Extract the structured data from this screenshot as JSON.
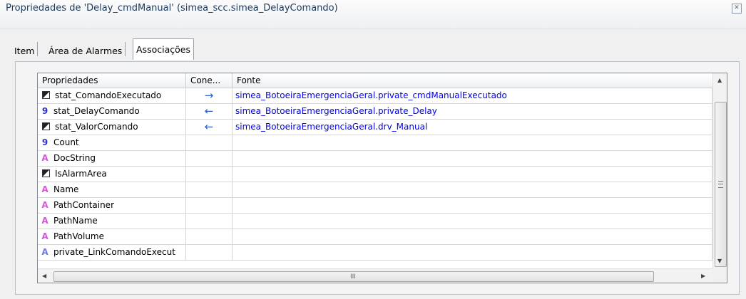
{
  "window": {
    "title": "Propriedades de 'Delay_cmdManual' (simea_scc.simea_DelayComando)",
    "close_icon": "close-icon"
  },
  "tabs": [
    {
      "label": "Item",
      "active": false
    },
    {
      "label": "Área de Alarmes",
      "active": false
    },
    {
      "label": "Associações",
      "active": true
    }
  ],
  "grid": {
    "columns": [
      "Propriedades",
      "Cone...",
      "Fonte"
    ],
    "rows": [
      {
        "icon": "bool",
        "name": "stat_ComandoExecutado",
        "connection": "→",
        "source": "simea_BotoeiraEmergenciaGeral.private_cmdManualExecutado"
      },
      {
        "icon": "int",
        "name": "stat_DelayComando",
        "connection": "←",
        "source": "simea_BotoeiraEmergenciaGeral.private_Delay"
      },
      {
        "icon": "bool",
        "name": "stat_ValorComando",
        "connection": "←",
        "source": "simea_BotoeiraEmergenciaGeral.drv_Manual"
      },
      {
        "icon": "int",
        "name": "Count",
        "connection": "",
        "source": ""
      },
      {
        "icon": "str-pink",
        "name": "DocString",
        "connection": "",
        "source": ""
      },
      {
        "icon": "bool",
        "name": "IsAlarmArea",
        "connection": "",
        "source": ""
      },
      {
        "icon": "str-pink",
        "name": "Name",
        "connection": "",
        "source": ""
      },
      {
        "icon": "str-pink",
        "name": "PathContainer",
        "connection": "",
        "source": ""
      },
      {
        "icon": "str-pink",
        "name": "PathName",
        "connection": "",
        "source": ""
      },
      {
        "icon": "str-pink",
        "name": "PathVolume",
        "connection": "",
        "source": ""
      },
      {
        "icon": "str-blue",
        "name": "private_LinkComandoExecut",
        "connection": "",
        "source": ""
      }
    ],
    "type_glyphs": {
      "int": "9",
      "str-pink": "A",
      "str-blue": "A"
    }
  },
  "colors": {
    "link": "#0000ee",
    "arrow": "#2a60c8",
    "title": "#1e395b"
  }
}
